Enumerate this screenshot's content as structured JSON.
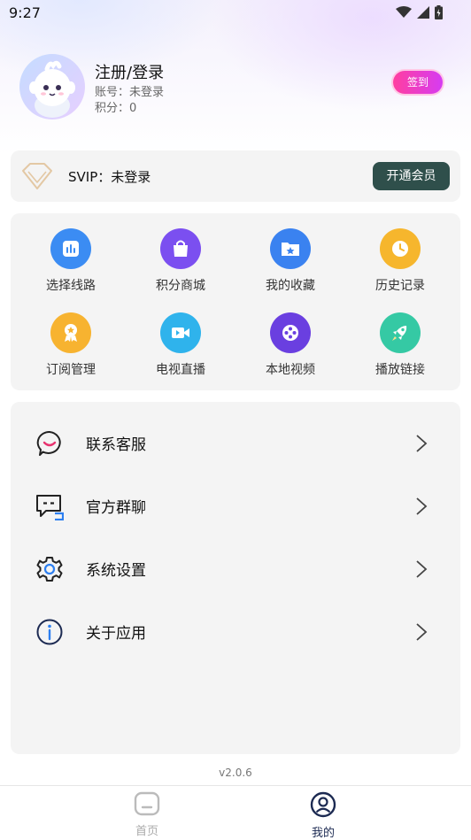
{
  "status_bar": {
    "time": "9:27"
  },
  "profile": {
    "name": "注册/登录",
    "account": "账号：未登录",
    "points": "积分：0",
    "signin_label": "签到"
  },
  "svip": {
    "text": "SVIP：未登录",
    "button_label": "开通会员"
  },
  "grid": [
    {
      "label": "选择线路",
      "icon": "route-icon",
      "color": "#3b8cf3"
    },
    {
      "label": "积分商城",
      "icon": "shopping-bag-icon",
      "color": "#7b4ff0"
    },
    {
      "label": "我的收藏",
      "icon": "favorite-folder-icon",
      "color": "#3a82f0"
    },
    {
      "label": "历史记录",
      "icon": "clock-icon",
      "color": "#f6b62d"
    },
    {
      "label": "订阅管理",
      "icon": "award-icon",
      "color": "#f7b330"
    },
    {
      "label": "电视直播",
      "icon": "video-camera-icon",
      "color": "#2fb3ec"
    },
    {
      "label": "本地视频",
      "icon": "film-reel-icon",
      "color": "#6a3fe0"
    },
    {
      "label": "播放链接",
      "icon": "rocket-icon",
      "color": "#35c9a4"
    }
  ],
  "menu": [
    {
      "label": "联系客服",
      "icon": "customer-service-icon"
    },
    {
      "label": "官方群聊",
      "icon": "group-chat-icon"
    },
    {
      "label": "系统设置",
      "icon": "settings-gear-icon"
    },
    {
      "label": "关于应用",
      "icon": "info-icon"
    }
  ],
  "version": "v2.0.6",
  "tabs": [
    {
      "label": "首页",
      "icon": "home-icon",
      "active": false
    },
    {
      "label": "我的",
      "icon": "profile-icon",
      "active": true
    }
  ],
  "colors": {
    "accent_dark": "#2f4f4b",
    "signin_gradient_start": "#ff3fa0",
    "signin_gradient_end": "#d63cf2",
    "card_bg": "#f4f4f4"
  }
}
